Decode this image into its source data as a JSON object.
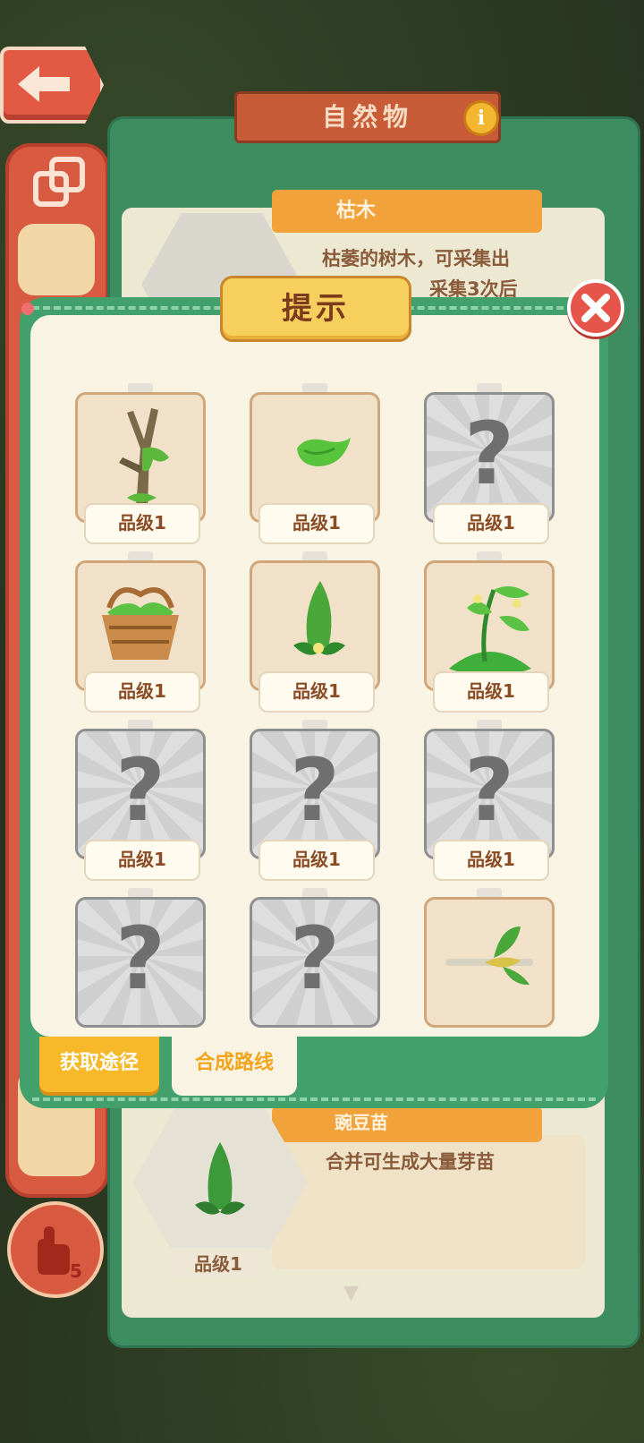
{
  "background": {
    "panel_title": "自然物",
    "top_item_name": "枯木",
    "top_item_desc_line1": "枯萎的树木，可采集出",
    "top_item_desc_line2": "采集3次后",
    "bottom_item_name": "豌豆苗",
    "bottom_item_desc": "合并可生成大量芽苗",
    "bottom_item_level": "品级1",
    "hand_count": "5"
  },
  "modal": {
    "title": "提示",
    "items": [
      {
        "icon": "dead-tree-icon",
        "known": true,
        "level": "品级1"
      },
      {
        "icon": "pea-sprout-icon",
        "known": true,
        "level": "品级1"
      },
      {
        "icon": "unknown-question-icon",
        "known": false,
        "level": "品级1"
      },
      {
        "icon": "pea-basket-icon",
        "known": true,
        "level": "品级1"
      },
      {
        "icon": "pea-seedling-icon",
        "known": true,
        "level": "品级1"
      },
      {
        "icon": "pea-plant-icon",
        "known": true,
        "level": "品级1"
      },
      {
        "icon": "unknown-question-icon",
        "known": false,
        "level": "品级1"
      },
      {
        "icon": "unknown-question-icon",
        "known": false,
        "level": "品级1"
      },
      {
        "icon": "unknown-question-icon",
        "known": false,
        "level": "品级1"
      },
      {
        "icon": "unknown-question-icon",
        "known": false,
        "level": ""
      },
      {
        "icon": "unknown-question-icon",
        "known": false,
        "level": ""
      },
      {
        "icon": "pea-branch-icon",
        "known": true,
        "level": ""
      }
    ],
    "tabs": {
      "get_route": "获取途径",
      "merge_route": "合成路线"
    }
  }
}
